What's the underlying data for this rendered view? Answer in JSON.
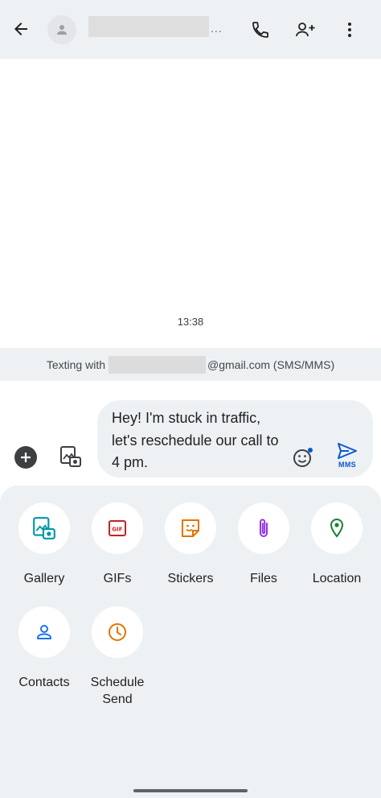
{
  "header": {
    "back_icon": "arrow-left-icon",
    "avatar_icon": "person-icon",
    "name_ellipsis": "...",
    "call_icon": "phone-icon",
    "add_person_icon": "person-add-icon",
    "more_icon": "more-vert-icon"
  },
  "conversation": {
    "timestamp": "13:38",
    "texting_prefix": "Texting with",
    "texting_suffix": "@gmail.com (SMS/MMS)"
  },
  "compose": {
    "text": "Hey! I'm stuck in traffic, let's reschedule our call to 4 pm.",
    "send_label": "MMS",
    "plus_icon": "plus-icon",
    "gallery_icon": "gallery-icon",
    "emoji_icon": "emoji-icon",
    "send_icon": "send-icon"
  },
  "attachments": {
    "items": [
      {
        "label": "Gallery",
        "icon": "gallery-icon",
        "color": "#0097a7"
      },
      {
        "label": "GIFs",
        "icon": "gif-icon",
        "color": "#c5221f"
      },
      {
        "label": "Stickers",
        "icon": "sticker-icon",
        "color": "#e37400"
      },
      {
        "label": "Files",
        "icon": "paperclip-icon",
        "color": "#9334e6"
      },
      {
        "label": "Location",
        "icon": "location-pin-icon",
        "color": "#188038"
      },
      {
        "label": "Contacts",
        "icon": "contact-icon",
        "color": "#1a73e8"
      },
      {
        "label": "Schedule Send",
        "label_line1": "Schedule",
        "label_line2": "Send",
        "icon": "clock-icon",
        "color": "#e37400"
      }
    ]
  },
  "colors": {
    "appbar_bg": "#eef1f4",
    "panel_bg": "#eef1f4",
    "send_accent": "#0b57d0"
  }
}
